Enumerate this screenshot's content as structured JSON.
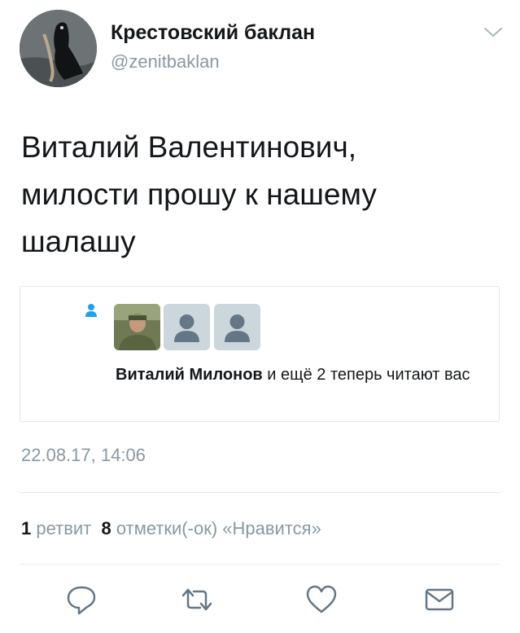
{
  "author": {
    "display_name": "Крестовский баклан",
    "handle": "@zenitbaklan"
  },
  "tweet": {
    "text": "Виталий Валентинович,\nмилости прошу к нашему\nшалашу"
  },
  "card": {
    "icon": "person-icon",
    "follower_name": "Виталий Милонов",
    "message_suffix": " и ещё 2 теперь читают вас"
  },
  "meta": {
    "timestamp": "22.08.17, 14:06"
  },
  "stats": {
    "retweet_count": "1",
    "retweet_label": "ретвит",
    "like_count": "8",
    "like_label": "отметки(-ок) «Нравится»"
  },
  "actions": {
    "icons": [
      "reply-icon",
      "retweet-icon",
      "like-icon",
      "direct-message-icon"
    ]
  },
  "colors": {
    "accent": "#1da1f2",
    "muted": "#8899a6",
    "text": "#14171a",
    "border": "#e1e8ed"
  }
}
